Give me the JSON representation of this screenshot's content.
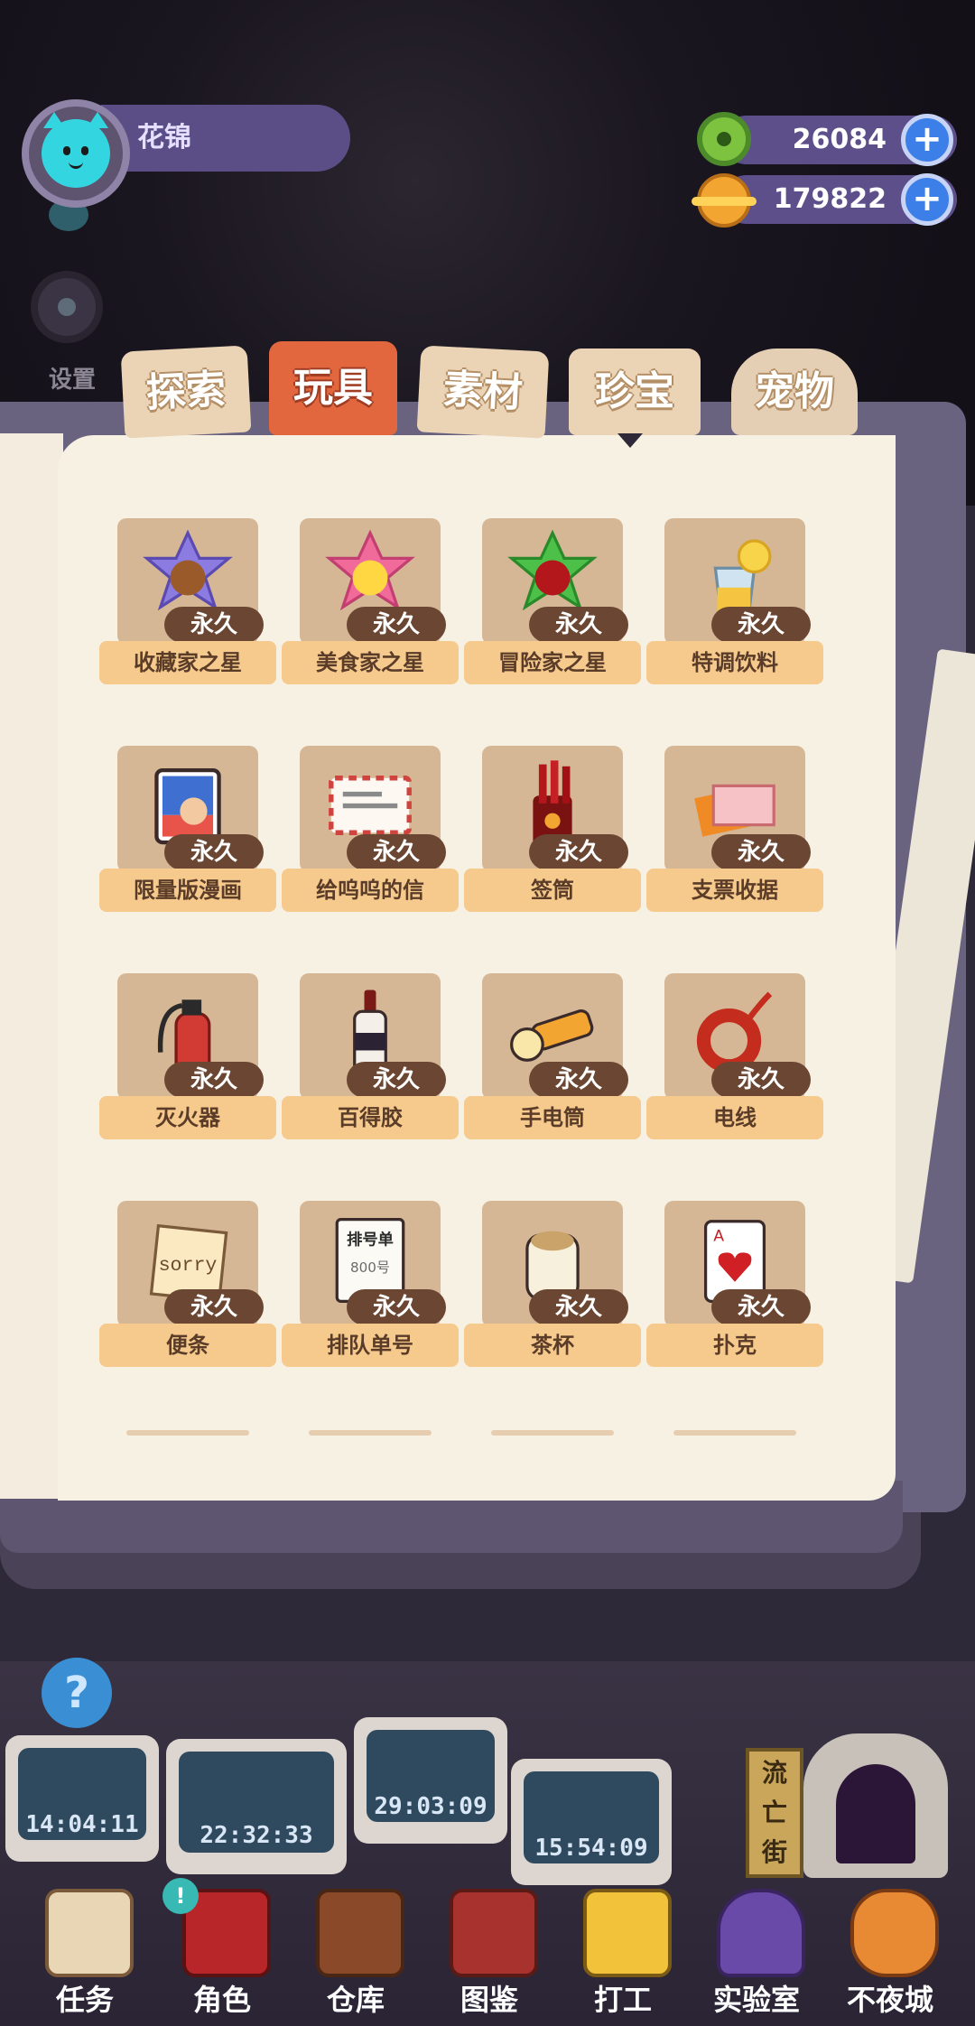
{
  "player": {
    "name": "花锦",
    "settings_label": "设置"
  },
  "currencies": [
    {
      "icon": "green-donut-coin-icon",
      "value": "26084",
      "plus": "+"
    },
    {
      "icon": "orange-planet-coin-icon",
      "value": "179822",
      "plus": "+"
    }
  ],
  "tabs": [
    {
      "label": "探索",
      "active": false
    },
    {
      "label": "玩具",
      "active": true
    },
    {
      "label": "素材",
      "active": false
    },
    {
      "label": "珍宝",
      "active": false
    },
    {
      "label": "宠物",
      "active": false
    }
  ],
  "items": [
    {
      "name": "收藏家之星",
      "duration": "永久",
      "icon": "purple-star-badge-icon"
    },
    {
      "name": "美食家之星",
      "duration": "永久",
      "icon": "pink-star-badge-icon"
    },
    {
      "name": "冒险家之星",
      "duration": "永久",
      "icon": "green-star-badge-icon"
    },
    {
      "name": "特调饮料",
      "duration": "永久",
      "icon": "drink-cup-icon"
    },
    {
      "name": "限量版漫画",
      "duration": "永久",
      "icon": "comic-book-icon"
    },
    {
      "name": "给呜呜的信",
      "duration": "永久",
      "icon": "letter-envelope-icon"
    },
    {
      "name": "签筒",
      "duration": "永久",
      "icon": "fortune-stick-cup-icon"
    },
    {
      "name": "支票收据",
      "duration": "永久",
      "icon": "cheque-receipt-icon"
    },
    {
      "name": "灭火器",
      "duration": "永久",
      "icon": "fire-extinguisher-icon"
    },
    {
      "name": "百得胶",
      "duration": "永久",
      "icon": "glue-bottle-icon"
    },
    {
      "name": "手电筒",
      "duration": "永久",
      "icon": "flashlight-icon"
    },
    {
      "name": "电线",
      "duration": "永久",
      "icon": "wire-coil-icon"
    },
    {
      "name": "便条",
      "duration": "永久",
      "icon": "sorry-note-icon"
    },
    {
      "name": "排队单号",
      "duration": "永久",
      "icon": "queue-ticket-icon"
    },
    {
      "name": "茶杯",
      "duration": "永久",
      "icon": "tea-cup-icon"
    },
    {
      "name": "扑克",
      "duration": "永久",
      "icon": "playing-card-icon"
    }
  ],
  "item_art_text": {
    "sorry": "sorry",
    "ticket_title": "排号单",
    "ticket_number": "800号",
    "card_rank": "A"
  },
  "timers": [
    "14:04:11",
    "22:32:33",
    "29:03:09",
    "15:54:09"
  ],
  "street_sign": [
    "流",
    "亡",
    "街"
  ],
  "help_glyph": "?",
  "nav": [
    {
      "label": "任务",
      "icon": "task-clipboard-icon"
    },
    {
      "label": "角色",
      "icon": "character-card-icon"
    },
    {
      "label": "仓库",
      "icon": "warehouse-chest-icon"
    },
    {
      "label": "图鉴",
      "icon": "encyclopedia-book-icon"
    },
    {
      "label": "打工",
      "icon": "work-monitor-icon"
    },
    {
      "label": "实验室",
      "icon": "lab-jar-icon"
    },
    {
      "label": "不夜城",
      "icon": "city-cat-icon"
    }
  ],
  "colors": {
    "active_tab": "#e2673f",
    "badge": "#6b4632",
    "label_bar": "#f6c98c",
    "currency_bar": "#5d4f8a"
  }
}
